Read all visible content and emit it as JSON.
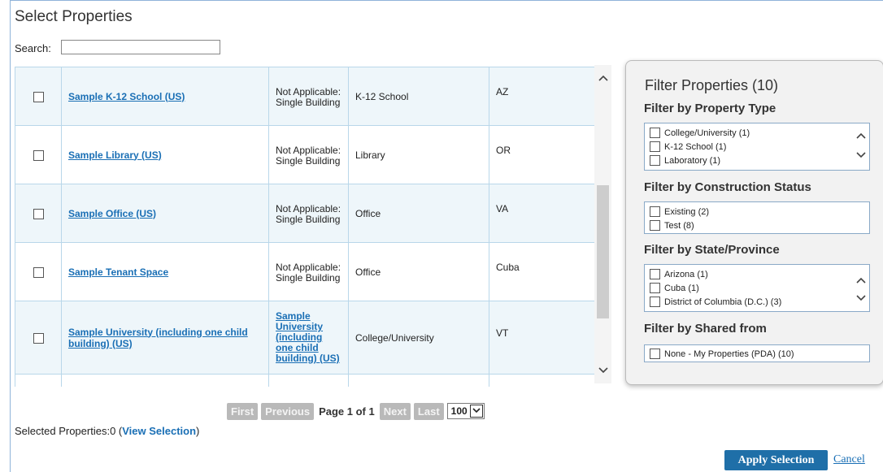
{
  "dialog": {
    "title": "Select Properties"
  },
  "search": {
    "label": "Search:",
    "value": "",
    "placeholder": ""
  },
  "table": {
    "rows": [
      {
        "name": "Sample K-12 School (US)",
        "sub": "Not Applicable: Single Building",
        "sub_is_link": false,
        "type": "K-12 School",
        "state": "AZ"
      },
      {
        "name": "Sample Library (US)",
        "sub": "Not Applicable: Single Building",
        "sub_is_link": false,
        "type": "Library",
        "state": "OR"
      },
      {
        "name": "Sample Office (US)",
        "sub": "Not Applicable: Single Building",
        "sub_is_link": false,
        "type": "Office",
        "state": "VA"
      },
      {
        "name": "Sample Tenant Space",
        "sub": "Not Applicable: Single Building",
        "sub_is_link": false,
        "type": "Office",
        "state": "Cuba"
      },
      {
        "name": "Sample University (including one child building) (US)",
        "sub": "Sample University (including one child building) (US)",
        "sub_is_link": true,
        "type": "College/University",
        "state": "VT"
      }
    ]
  },
  "pager": {
    "first": "First",
    "previous": "Previous",
    "page_text": "Page 1 of 1",
    "next": "Next",
    "last": "Last",
    "page_size": "100"
  },
  "selection": {
    "prefix": "Selected Properties:0 (",
    "view_link": "View Selection",
    "suffix": ")"
  },
  "actions": {
    "apply": "Apply Selection",
    "cancel": "Cancel"
  },
  "filters": {
    "title": "Filter Properties (10)",
    "groups": [
      {
        "heading": "Filter by Property Type",
        "items": [
          "College/University (1)",
          "K-12 School (1)",
          "Laboratory (1)"
        ]
      },
      {
        "heading": "Filter by Construction Status",
        "items": [
          "Existing (2)",
          "Test (8)"
        ]
      },
      {
        "heading": "Filter by State/Province",
        "items": [
          "Arizona (1)",
          "Cuba (1)",
          "District of Columbia (D.C.) (3)"
        ]
      },
      {
        "heading": "Filter by Shared from",
        "items": [
          "None - My Properties (PDA) (10)"
        ]
      }
    ]
  },
  "colors": {
    "link": "#1a6fb5",
    "apply_button": "#1f6fa8",
    "row_tint": "#eef6fa",
    "pager_disabled": "#b9b9b9"
  }
}
